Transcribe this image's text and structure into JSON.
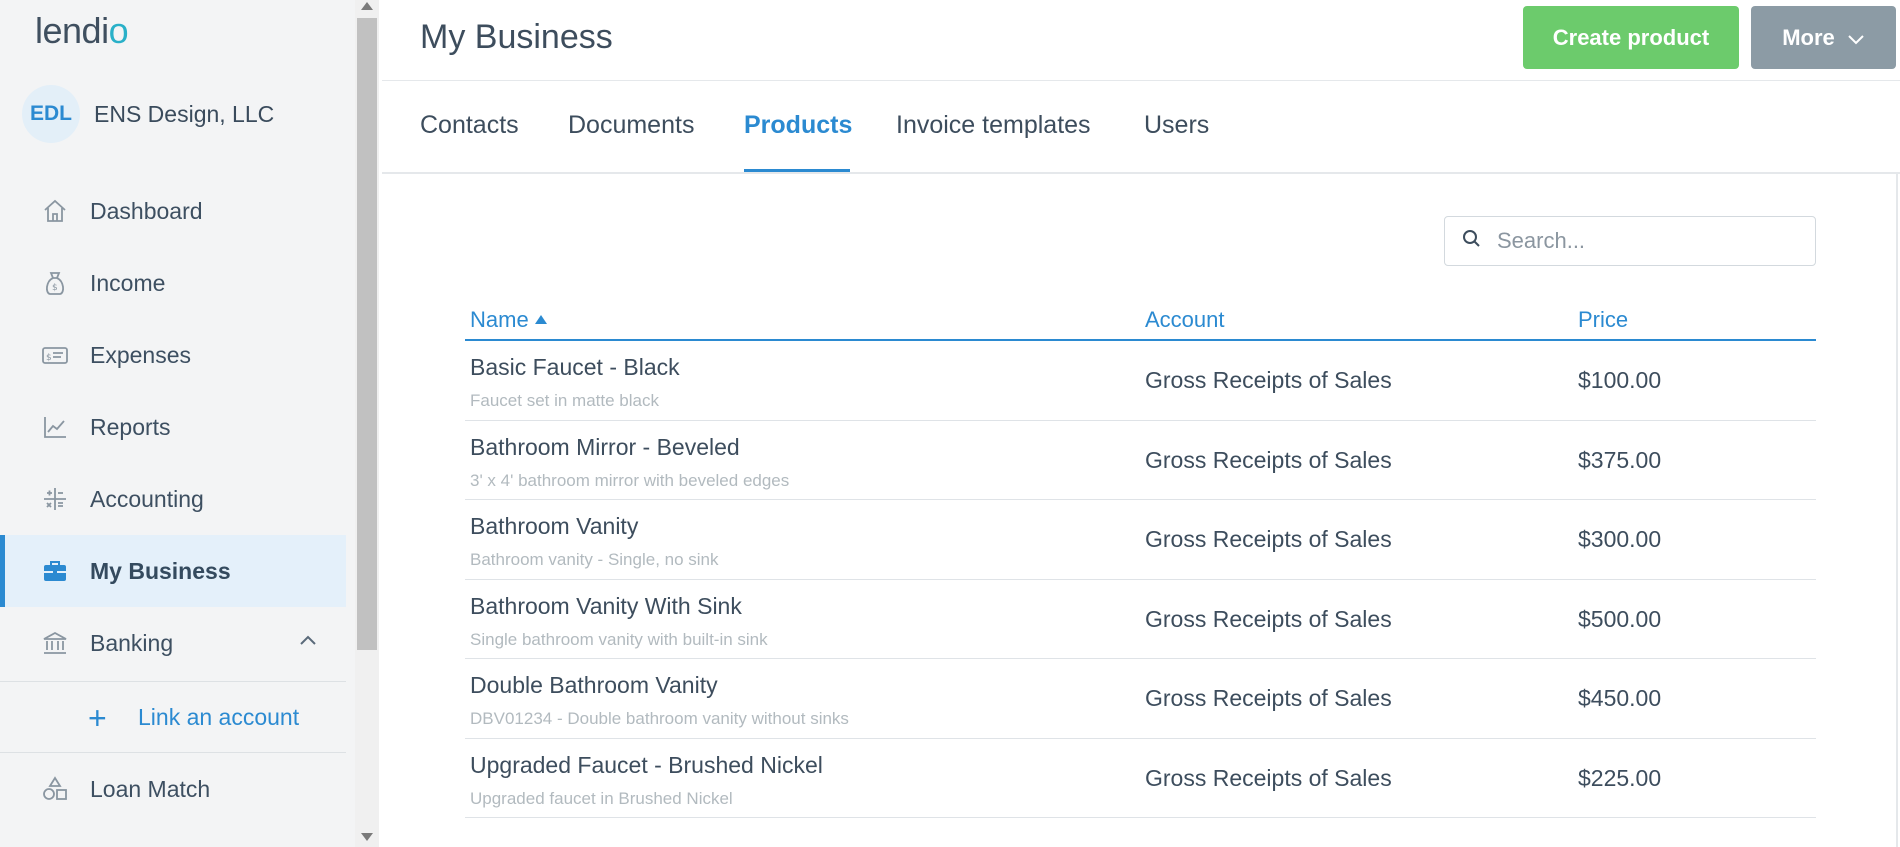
{
  "brand": {
    "logo_text": "lendi",
    "logo_o": "o"
  },
  "company": {
    "initials": "EDL",
    "name": "ENS Design, LLC"
  },
  "sidebar": {
    "items": [
      {
        "label": "Dashboard",
        "icon": "home-icon"
      },
      {
        "label": "Income",
        "icon": "money-bag-icon"
      },
      {
        "label": "Expenses",
        "icon": "receipt-icon"
      },
      {
        "label": "Reports",
        "icon": "line-chart-icon"
      },
      {
        "label": "Accounting",
        "icon": "calculator-icon"
      },
      {
        "label": "My Business",
        "icon": "briefcase-icon",
        "active": true
      },
      {
        "label": "Banking",
        "icon": "bank-icon"
      }
    ],
    "link_account": "Link an account",
    "loan_match": "Loan Match"
  },
  "header": {
    "title": "My Business",
    "create_label": "Create product",
    "more_label": "More"
  },
  "tabs": [
    {
      "label": "Contacts"
    },
    {
      "label": "Documents"
    },
    {
      "label": "Products",
      "active": true
    },
    {
      "label": "Invoice templates"
    },
    {
      "label": "Users"
    }
  ],
  "search": {
    "placeholder": "Search..."
  },
  "table": {
    "columns": [
      "Name",
      "Account",
      "Price"
    ],
    "rows": [
      {
        "name": "Basic Faucet - Black",
        "desc": "Faucet set in matte black",
        "account": "Gross Receipts of Sales",
        "price": "$100.00"
      },
      {
        "name": "Bathroom Mirror - Beveled",
        "desc": "3' x 4' bathroom mirror with beveled edges",
        "account": "Gross Receipts of Sales",
        "price": "$375.00"
      },
      {
        "name": "Bathroom Vanity",
        "desc": "Bathroom vanity - Single, no sink",
        "account": "Gross Receipts of Sales",
        "price": "$300.00"
      },
      {
        "name": "Bathroom Vanity With Sink",
        "desc": "Single bathroom vanity with built-in sink",
        "account": "Gross Receipts of Sales",
        "price": "$500.00"
      },
      {
        "name": "Double Bathroom Vanity",
        "desc": "DBV01234 - Double bathroom vanity without sinks",
        "account": "Gross Receipts of Sales",
        "price": "$450.00"
      },
      {
        "name": "Upgraded Faucet - Brushed Nickel",
        "desc": "Upgraded faucet in Brushed Nickel",
        "account": "Gross Receipts of Sales",
        "price": "$225.00"
      }
    ]
  },
  "colors": {
    "accent": "#2b8ad1",
    "create_button": "#6ccb6c",
    "more_button": "#8c9ba5",
    "active_nav_bg": "#e4f0fa"
  }
}
